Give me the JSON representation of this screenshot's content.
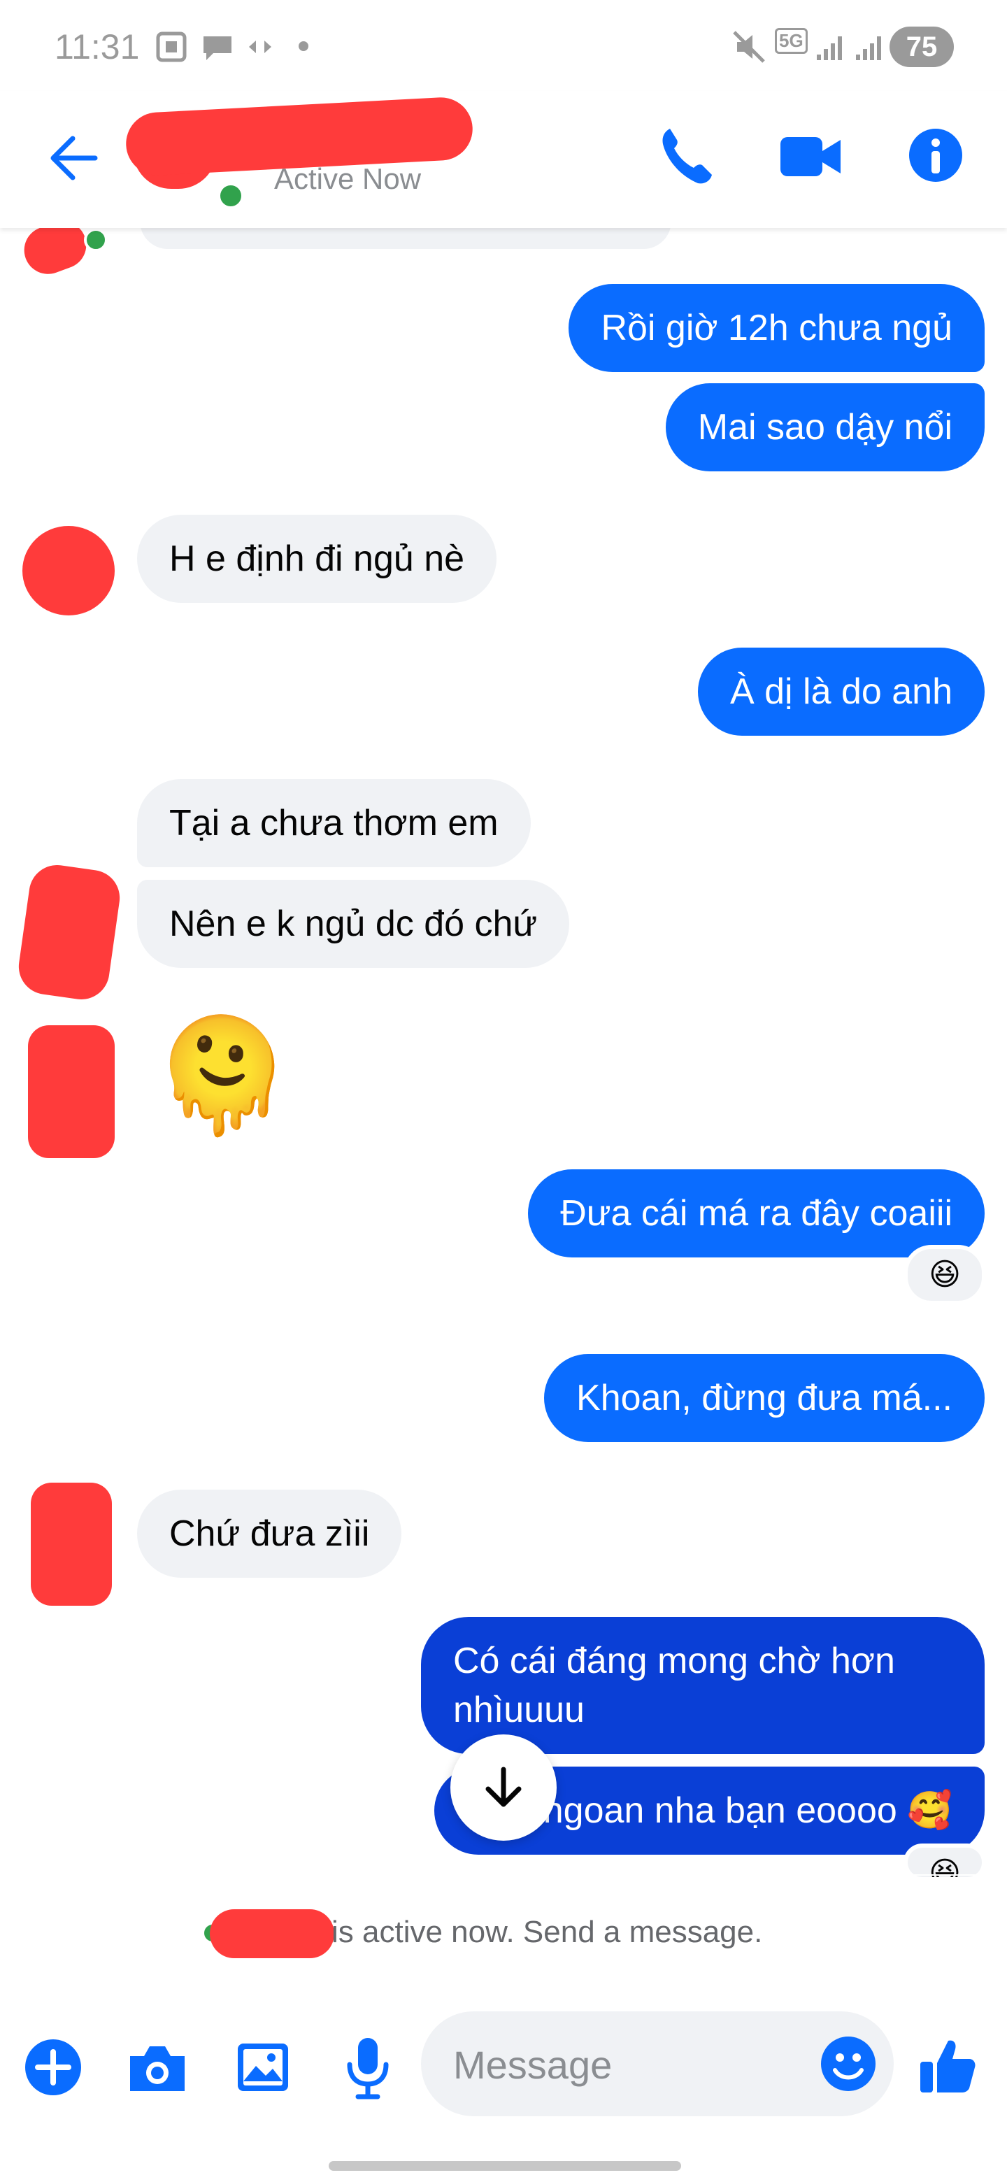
{
  "status_bar": {
    "time": "11:31",
    "network": "5G",
    "battery": "75"
  },
  "header": {
    "contact_status": "Active Now"
  },
  "messages": [
    {
      "side": "out",
      "text": "Rồi giờ 12h chưa ngủ"
    },
    {
      "side": "out",
      "text": "Mai sao dậy nổi"
    },
    {
      "side": "in",
      "text": "H e định đi ngủ nè"
    },
    {
      "side": "out",
      "text": "À dị là do anh"
    },
    {
      "side": "in",
      "text": "Tại a chưa thơm em"
    },
    {
      "side": "in",
      "text": "Nên e k ngủ dc đó chứ"
    },
    {
      "side": "in",
      "text": "🫠"
    },
    {
      "side": "out",
      "text": "Đưa cái má ra đây coaiii",
      "reaction": "😆"
    },
    {
      "side": "out",
      "text": "Khoan, đừng đưa má..."
    },
    {
      "side": "in",
      "text": "Chứ đưa zìii"
    },
    {
      "side": "out",
      "text": "Có cái đáng mong chờ hơn nhìuuuu"
    },
    {
      "side": "out",
      "text": "Ngủ ngoan nha bạn eoooo 🥰",
      "reaction": "😆"
    }
  ],
  "active_notice": "is active now. Send a message.",
  "composer": {
    "placeholder": "Message"
  },
  "colors": {
    "accent": "#0a6cff",
    "accent_dark": "#0a3fd6",
    "incoming_bubble": "#f0f2f5",
    "online_dot": "#31a24c"
  }
}
